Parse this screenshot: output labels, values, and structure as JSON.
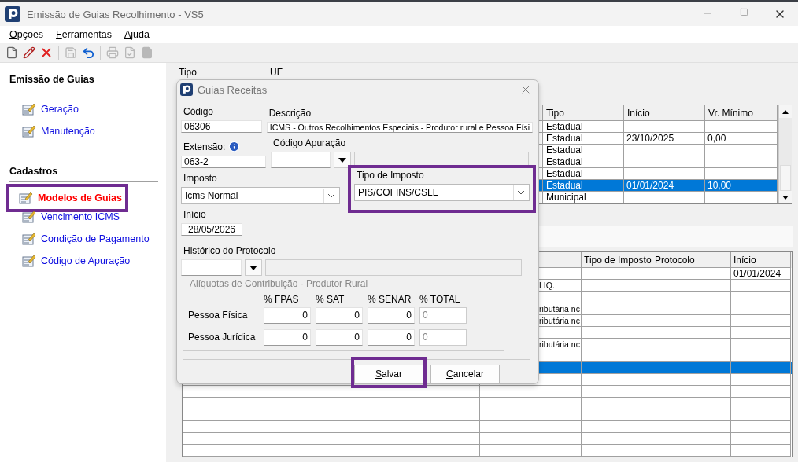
{
  "window": {
    "title": "Emissão de Guias Recolhimento - VS5"
  },
  "menu": [
    "Opções",
    "Ferramentas",
    "Ajuda"
  ],
  "toolbar": [
    {
      "kind": "new",
      "disabled": false
    },
    {
      "kind": "edit",
      "disabled": false
    },
    {
      "kind": "delete",
      "disabled": false
    },
    {
      "kind": "separator"
    },
    {
      "kind": "save",
      "disabled": true
    },
    {
      "kind": "undo",
      "disabled": false
    },
    {
      "kind": "separator"
    },
    {
      "kind": "print",
      "disabled": true
    },
    {
      "kind": "check",
      "disabled": true
    },
    {
      "kind": "page",
      "disabled": true
    }
  ],
  "sidebar": [
    {
      "title": "Emissão de Guias",
      "items": [
        {
          "label": "Geração",
          "selected": false,
          "highlighted": false
        },
        {
          "label": "Manutenção",
          "selected": false,
          "highlighted": false
        }
      ]
    },
    {
      "title": "Cadastros",
      "items": [
        {
          "label": "Modelos de Guias",
          "selected": true,
          "highlighted": true
        },
        {
          "label": "Vencimento ICMS",
          "selected": false,
          "highlighted": false
        },
        {
          "label": "Condição de Pagamento",
          "selected": false,
          "highlighted": false
        },
        {
          "label": "Código de Apuração",
          "selected": false,
          "highlighted": false
        }
      ]
    }
  ],
  "filter_labels": [
    "Tipo",
    "UF"
  ],
  "top_grid": {
    "columns": [
      "Tipo",
      "Início",
      "Vr. Mínimo"
    ],
    "rows": [
      {
        "tipo": "Estadual",
        "selected": false
      },
      {
        "tipo": "Estadual",
        "inicio": "23/10/2025",
        "vr_minimo": "0,00",
        "selected": false
      },
      {
        "tipo": "Estadual",
        "selected": false
      },
      {
        "tipo": "Estadual",
        "selected": false
      },
      {
        "tipo": "Estadual",
        "selected": false
      },
      {
        "tipo": "Estadual",
        "inicio": "01/01/2024",
        "vr_minimo": "10,00",
        "selected": true
      },
      {
        "tipo": "Municipal",
        "selected": false
      }
    ]
  },
  "bottom_grid": {
    "columns": [
      "Tipo de Imposto",
      "Protocolo",
      "Início"
    ],
    "rows": [
      {
        "inicio": "01/01/2024",
        "selected": false
      },
      {
        "column_4": "LIQ.",
        "selected": false
      },
      {
        "selected": false
      },
      {
        "column_4": "ributária nc",
        "selected": false
      },
      {
        "column_4": "ributária nc",
        "selected": false
      },
      {
        "selected": false
      },
      {
        "column_4": "ributária nc",
        "selected": false
      },
      {
        "selected": false
      },
      {
        "selected": true
      },
      {
        "selected": false
      },
      {
        "selected": false
      },
      {
        "selected": false
      },
      {
        "selected": false
      },
      {
        "selected": false
      },
      {
        "selected": false
      },
      {
        "selected": false
      }
    ]
  },
  "dialog": {
    "title": "Guias Receitas",
    "codigo": {
      "label": "Código",
      "value": "06306"
    },
    "descricao": {
      "label": "Descrição",
      "value": "ICMS - Outros Recolhimentos Especiais - Produtor rural e Pessoa Físi"
    },
    "extensao": {
      "label": "Extensão:",
      "value": "063-2"
    },
    "codigo_apuracao": {
      "label": "Código Apuração"
    },
    "imposto": {
      "label": "Imposto",
      "value": "Icms Normal"
    },
    "tipo_de_imposto": {
      "label": "Tipo de Imposto",
      "value": "PIS/COFINS/CSLL",
      "highlighted": true
    },
    "inicio": {
      "label": "Início",
      "value": "28/05/2026"
    },
    "historico_do_protocolo": {
      "label": "Histórico do Protocolo"
    },
    "aliquotas": {
      "title": "Alíquotas de Contribuição - Produtor Rural",
      "columns": [
        {
          "label": "% FPAS",
          "disabled": false
        },
        {
          "label": "% SAT",
          "disabled": false
        },
        {
          "label": "% SENAR",
          "disabled": false
        },
        {
          "label": "% TOTAL",
          "disabled": true
        }
      ],
      "rows": [
        {
          "label": "Pessoa Física",
          "values": [
            "0",
            "0",
            "0",
            "0"
          ]
        },
        {
          "label": "Pessoa Jurídica",
          "values": [
            "0",
            "0",
            "0",
            "0"
          ]
        }
      ]
    },
    "buttons": [
      {
        "label": "Salvar",
        "highlighted": true
      },
      {
        "label": "Cancelar",
        "highlighted": false
      }
    ]
  }
}
